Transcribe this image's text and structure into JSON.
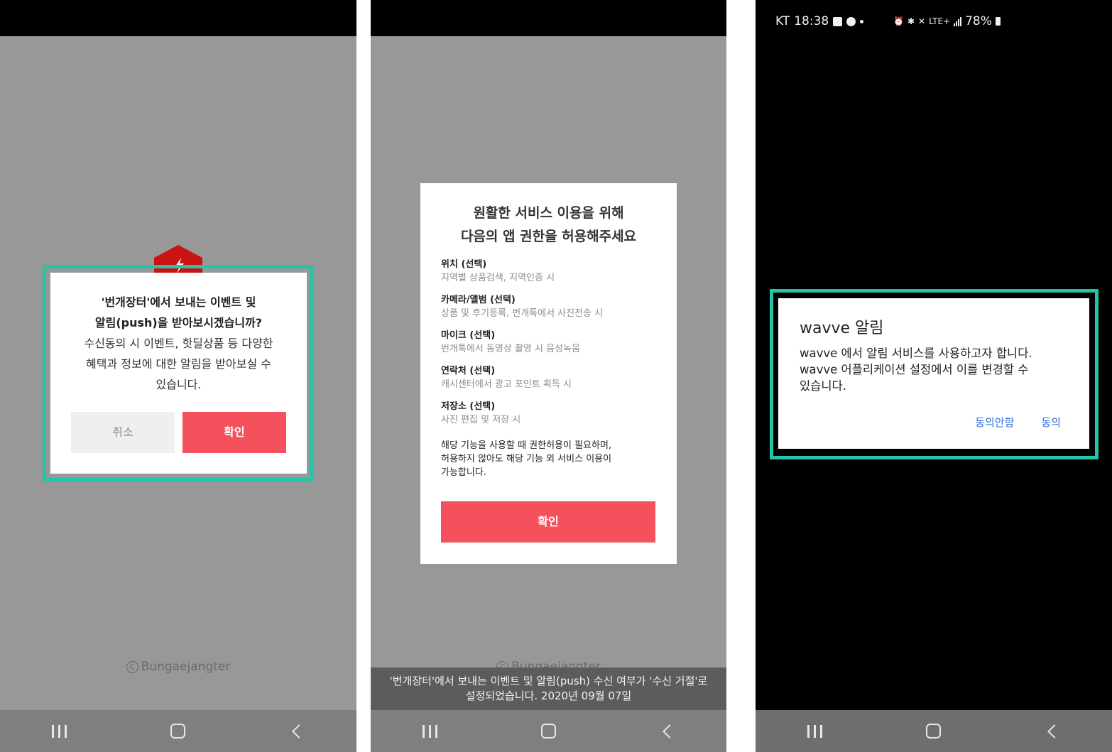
{
  "screen1": {
    "dialog": {
      "title": "'번개장터'에서 보내는 이벤트 및\n알림(push)을 받아보시겠습니까?",
      "body": "수신동의 시 이벤트, 핫딜상품 등 다양한\n혜택과 정보에 대한 알림을 받아보실 수\n있습니다.",
      "cancel_label": "취소",
      "confirm_label": "확인"
    },
    "copyright": "Bungaejangter",
    "logo_color": "#cc1313",
    "highlight_color": "#25c4a6"
  },
  "screen2": {
    "dialog": {
      "title": "원활한 서비스 이용을 위해\n다음의 앱 권한을 허용해주세요",
      "permissions": [
        {
          "name": "위치 (선택)",
          "desc": "지역별 상품검색, 지역인증 시"
        },
        {
          "name": "카메라/앨범 (선택)",
          "desc": "상품 및 후기등록, 번개톡에서 사진전송 시"
        },
        {
          "name": "마이크 (선택)",
          "desc": "번개톡에서 동영상 촬영 시 음성녹음"
        },
        {
          "name": "연락처 (선택)",
          "desc": "캐시센터에서 광고 포인트 획득 시"
        },
        {
          "name": "저장소 (선택)",
          "desc": "사진 편집 및 저장 시"
        }
      ],
      "note": "해당 기능을 사용할 때 권한허용이 필요하며,\n허용하지 않아도 해당 기능 외 서비스 이용이\n가능합니다.",
      "confirm_label": "확인"
    },
    "copyright": "Bungaejangter",
    "toast": "'번개장터'에서 보내는 이벤트 및 알림(push) 수신 여부가 '수신 거절'로\n설정되었습니다. 2020년 09월 07일"
  },
  "screen3": {
    "status": {
      "carrier": "KT",
      "time": "18:38",
      "network": "LTE+",
      "battery": "78%"
    },
    "dialog": {
      "title": "wavve 알림",
      "message": "wavve 에서 알림 서비스를 사용하고자 합니다.\nwavve 어플리케이션 설정에서 이를 변경할 수\n있습니다.",
      "deny_label": "동의안함",
      "allow_label": "동의"
    },
    "link_color": "#2c6fd6"
  },
  "nav_icons": [
    "recent-apps-icon",
    "home-icon",
    "back-icon"
  ]
}
